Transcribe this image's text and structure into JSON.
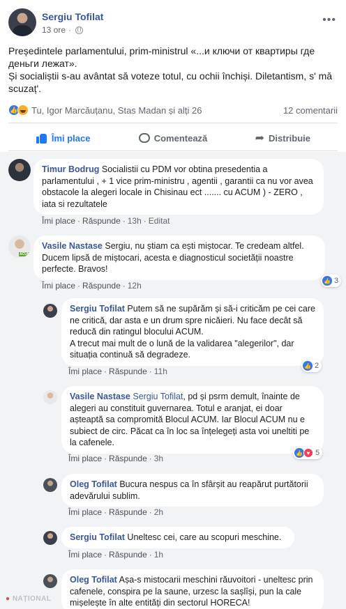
{
  "post": {
    "author": "Sergiu Tofilat",
    "time": "13 ore",
    "audience_icon": "globe-icon",
    "more_icon": "more-icon",
    "text_line1": "Președintele parlamentului, prim-ministrul «...и ключи от квартиры где деньги лежат».",
    "text_line2": "Și socialiștii s-au avântat să voteze totul, cu ochii închiși. Diletantism, s' mă scuzaț'.",
    "reactions_text": "Tu, Igor Marcăuțanu, Stas Madan și alți 26",
    "comments_count": "12 comentarii"
  },
  "actions": {
    "like": "Îmi place",
    "comment": "Comentează",
    "share": "Distribuie"
  },
  "comments": [
    {
      "author": "Timur Bodrug",
      "text": "Socialistii cu PDM vor obtina presedentia a parlamentului , + 1 vice prim-ministru , agentii , garantii ca nu vor avea obstacole la alegeri locale in Chisinau ect ....... cu ACUM ) - ZERO , iata si rezultatele",
      "like": "Îmi place",
      "reply": "Răspunde",
      "time": "13h",
      "edited": "Editat"
    },
    {
      "author": "Vasile Nastase",
      "text": "Sergiu, nu știam ca ești miștocar. Te credeam altfel. Ducem lipsă de miștocari, acesta e diagnosticul societății noastre perfecte. Bravos!",
      "like": "Îmi place",
      "reply": "Răspunde",
      "time": "12h",
      "reactions": "3"
    }
  ],
  "replies": [
    {
      "author": "Sergiu Tofilat",
      "text": "Putem să ne supărăm și să-i criticăm pe cei care ne critică, dar asta e un drum spre nicăieri. Nu face decât să reducă din ratingul blocului ACUM.",
      "text2": "A trecut mai mult de o lună de la validarea \"alegerilor\", dar situația continuă să degradeze.",
      "like": "Îmi place",
      "reply": "Răspunde",
      "time": "11h",
      "reactions": "2"
    },
    {
      "author": "Vasile Nastase",
      "mention": "Sergiu Tofilat",
      "text": ", pd și psrm demult, înainte de alegeri au constituit guvernarea. Totul e aranjat, ei doar așteaptă sa compromită Blocul ACUM. Iar Blocul ACUM nu e subiect de circ. Păcat ca în loc sa înțelegeți asta voi uneltiti pe la cafenele.",
      "like": "Îmi place",
      "reply": "Răspunde",
      "time": "3h",
      "reactions": "5"
    },
    {
      "author": "Oleg Tofilat",
      "text": "Bucura nespus ca în sfârșit au reapărut purtătorii adevărului sublim.",
      "like": "Îmi place",
      "reply": "Răspunde",
      "time": "2h"
    },
    {
      "author": "Sergiu Tofilat",
      "text": "Uneltesc cei, care au scopuri meschine.",
      "like": "Îmi place",
      "reply": "Răspunde",
      "time": "1h"
    },
    {
      "author": "Oleg Tofilat",
      "text": "Așa-s mistocarii meschini răuvoitori - uneltesc prin cafenele, conspira pe la saune, urzesc la sașlîși, pun la cale mișelește în alte entități din sectorul HORECA!"
    }
  ],
  "watermark": "NAȚIONAL",
  "badge": "ACUM"
}
